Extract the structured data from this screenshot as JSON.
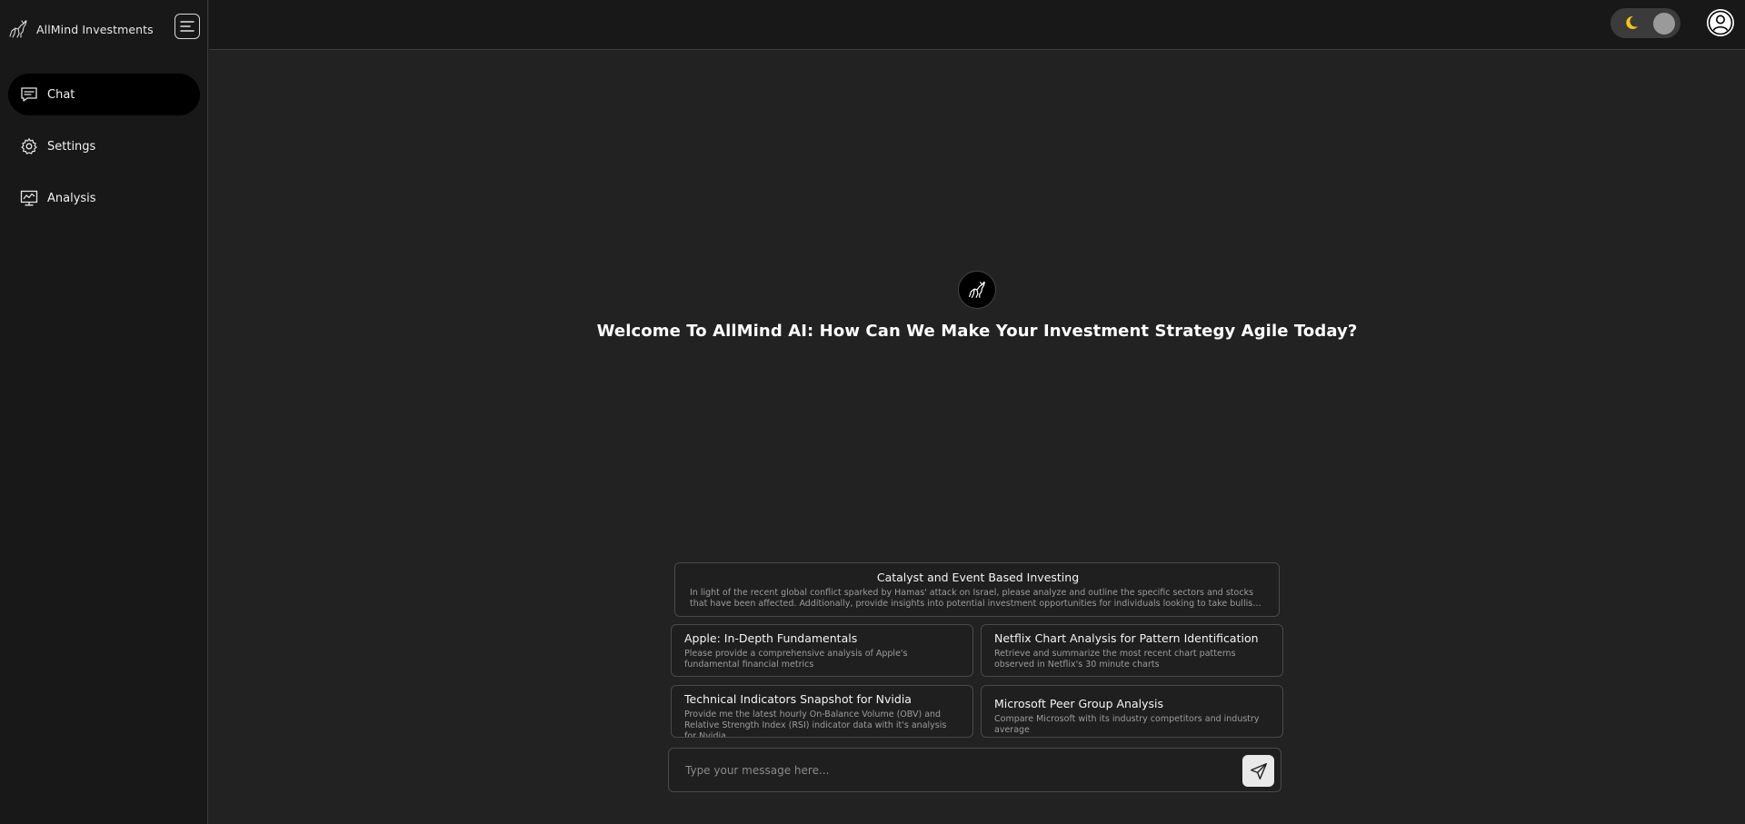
{
  "sidebar": {
    "brand_name": "AllMind Investments",
    "items": [
      {
        "label": "Chat",
        "icon": "chat-icon",
        "active": true
      },
      {
        "label": "Settings",
        "icon": "gear-icon",
        "active": false
      },
      {
        "label": "Analysis",
        "icon": "analysis-chart-icon",
        "active": false
      }
    ]
  },
  "header": {
    "theme_icon": "moon-icon",
    "avatar_icon": "user-icon"
  },
  "main": {
    "welcome": "Welcome To AllMind AI: How Can We Make Your Investment Strategy Agile Today?",
    "suggestions": [
      {
        "title": "Catalyst and Event Based Investing",
        "description": "In light of the recent global conflict sparked by Hamas' attack on Israel, please analyze and outline the specific sectors and stocks that have been affected. Additionally, provide insights into potential investment opportunities for individuals looking to take bullish or bearish positions in the market."
      },
      {
        "title": "Apple: In-Depth Fundamentals",
        "description": "Please provide a comprehensive analysis of Apple's fundamental financial metrics"
      },
      {
        "title": "Netflix Chart Analysis for Pattern Identification",
        "description": "Retrieve and summarize the most recent chart patterns observed in Netflix's 30 minute charts"
      },
      {
        "title": "Technical Indicators Snapshot for Nvidia",
        "description": "Provide me the latest hourly On-Balance Volume (OBV) and Relative Strength Index (RSI) indicator data with it's analysis for Nvidia."
      },
      {
        "title": "Microsoft Peer Group Analysis",
        "description": "Compare Microsoft with its industry competitors and industry average"
      }
    ],
    "composer": {
      "placeholder": "Type your message here...",
      "value": ""
    }
  },
  "colors": {
    "background": "#222222",
    "sidebar": "#181818",
    "active_nav": "#000000",
    "moon": "#f5c518"
  }
}
